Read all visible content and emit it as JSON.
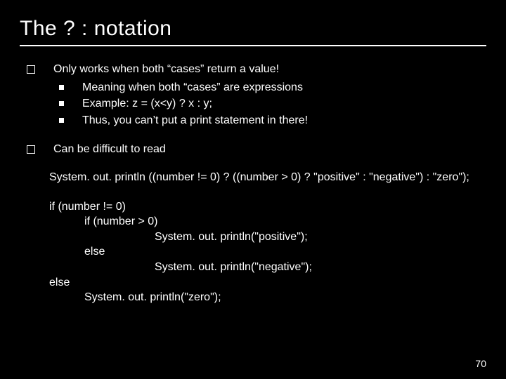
{
  "title": "The ? : notation",
  "bullets": {
    "b1": "Only works when both “cases” return a value!",
    "b1_1": "Meaning when both “cases” are expressions",
    "b1_2": "Example: z = (x<y) ? x : y;",
    "b1_3": "Thus, you can’t put a print statement in there!",
    "b2": "Can be difficult to read"
  },
  "snippet1": "System. out. println ((number != 0) ? ((number > 0) ? \"positive\" : \"negative\") : \"zero\");",
  "code": {
    "l1": "if (number != 0)",
    "l2": "if (number > 0)",
    "l3": "System. out. println(\"positive\");",
    "l4": "else",
    "l5": "System. out. println(\"negative\");",
    "l6": "else",
    "l7": "System. out. println(\"zero\");"
  },
  "page_number": "70"
}
